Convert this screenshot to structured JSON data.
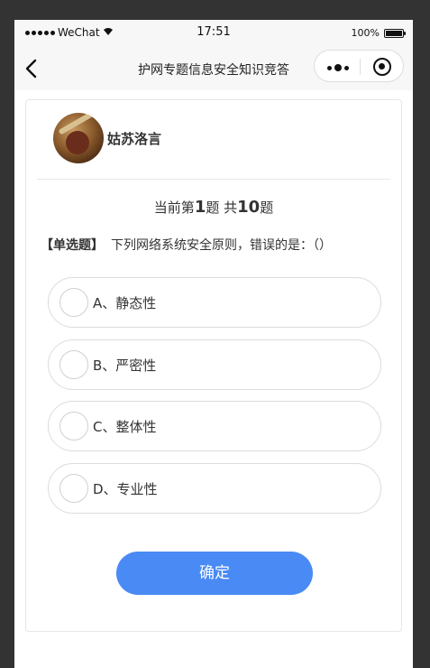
{
  "status_bar": {
    "carrier": "WeChat",
    "time": "17:51",
    "battery": "100%"
  },
  "nav": {
    "title": "护网专题信息安全知识竞答",
    "back_icon": "chevron-left-icon",
    "more_icon": "more-dots-icon",
    "close_icon": "target-icon"
  },
  "user": {
    "name": "姑苏洛言"
  },
  "progress": {
    "prefix": "当前第",
    "current": "1",
    "mid": "题 共",
    "total": "10",
    "suffix": "题"
  },
  "question": {
    "type": "【单选题】",
    "text": "下列网络系统安全原则，错误的是：（）"
  },
  "options": [
    {
      "label": "A、静态性"
    },
    {
      "label": "B、严密性"
    },
    {
      "label": "C、整体性"
    },
    {
      "label": "D、专业性"
    }
  ],
  "confirm_label": "确定",
  "colors": {
    "accent": "#4a8af4",
    "outer_bg": "#333333",
    "nav_bg": "#f7f7f7"
  }
}
